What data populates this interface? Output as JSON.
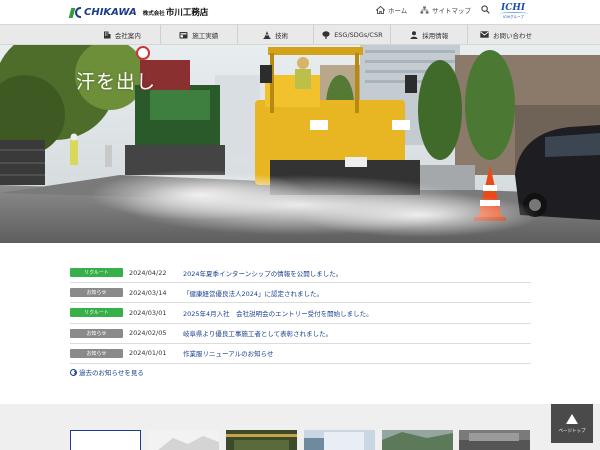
{
  "header": {
    "logo_text": "CHIKAWA",
    "logo_sub": "株式会社",
    "logo_name": "市川工務店",
    "home_label": "ホーム",
    "sitemap_label": "サイトマップ",
    "group_badge": "ICHI",
    "group_badge_sub": "ICHIグループ"
  },
  "nav": {
    "items": [
      {
        "label": "会社案内",
        "icon": "building-icon"
      },
      {
        "label": "施工実績",
        "icon": "construction-icon"
      },
      {
        "label": "技術",
        "icon": "cone-icon"
      },
      {
        "label": "ESG/SDGs/CSR",
        "icon": "tree-icon"
      },
      {
        "label": "採用情報",
        "icon": "person-icon"
      },
      {
        "label": "お問い合わせ",
        "icon": "mail-icon"
      }
    ]
  },
  "hero": {
    "caption": "汗を出し"
  },
  "news": {
    "items": [
      {
        "category": "リクルート",
        "type": "recruit",
        "date": "2024/04/22",
        "title": "2024年夏季インターンシップの情報を公開しました。"
      },
      {
        "category": "お知らせ",
        "type": "notice",
        "date": "2024/03/14",
        "title": "「健康経営優良法人2024」に認定されました。"
      },
      {
        "category": "リクルート",
        "type": "recruit",
        "date": "2024/03/01",
        "title": "2025年4月入社　会社説明会のエントリー受付を開始しました。"
      },
      {
        "category": "お知らせ",
        "type": "notice",
        "date": "2024/02/05",
        "title": "岐阜県より優良工事施工者として表彰されました。"
      },
      {
        "category": "お知らせ",
        "type": "notice",
        "date": "2024/01/01",
        "title": "作業服リニューアルのお知らせ"
      }
    ],
    "past_link": "過去のお知らせを見る"
  },
  "pagetop": {
    "label": "ページトップ"
  },
  "colors": {
    "recruit": "#37b04a",
    "notice": "#8a8a8a",
    "link": "#1a3f8f",
    "nav_bg": "#e9e9e9"
  }
}
